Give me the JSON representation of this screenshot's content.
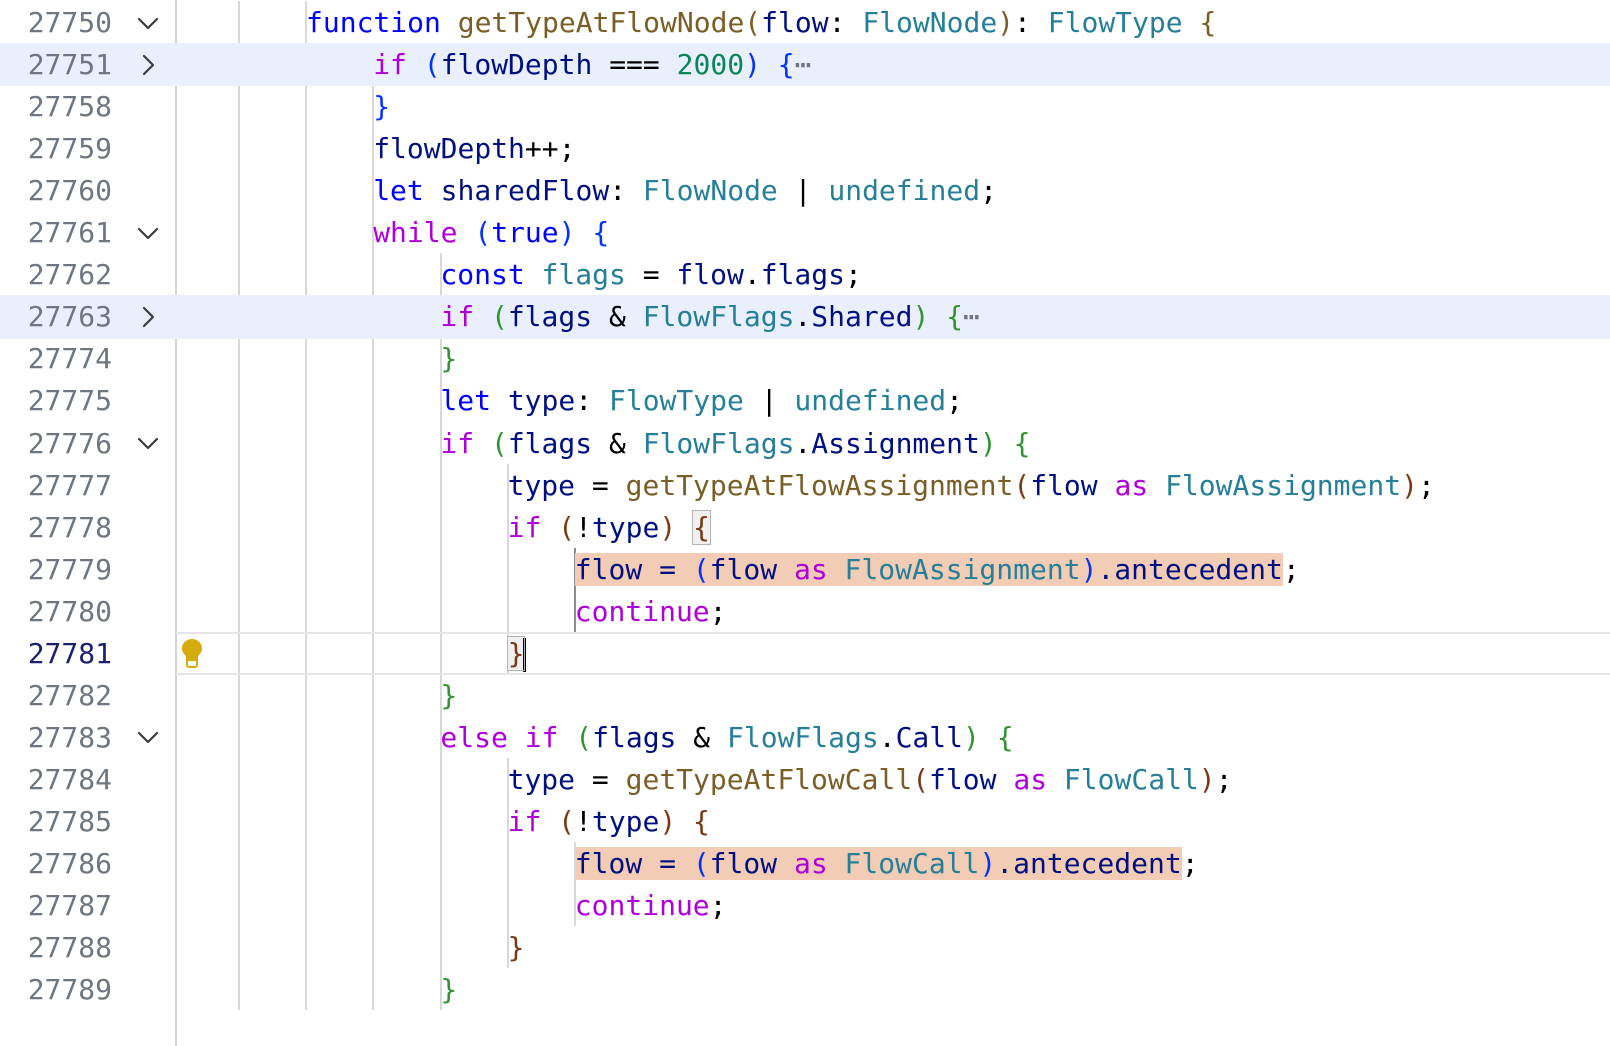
{
  "editor": {
    "language": "typescript",
    "lines": [
      {
        "number": "27750",
        "indent": 2,
        "fold": "expanded",
        "tokens": [
          [
            "function",
            "kw"
          ],
          [
            " ",
            "punc"
          ],
          [
            "getTypeAtFlowNode",
            "fn"
          ],
          [
            "(",
            "b1"
          ],
          [
            "flow",
            "var"
          ],
          [
            ": ",
            "punc"
          ],
          [
            "FlowNode",
            "type"
          ],
          [
            ")",
            "b1"
          ],
          [
            ": ",
            "punc"
          ],
          [
            "FlowType",
            "type"
          ],
          [
            " ",
            "punc"
          ],
          [
            "{",
            "b1"
          ]
        ]
      },
      {
        "number": "27751",
        "indent": 3,
        "fold": "collapsed",
        "highlight": "fold",
        "tokens": [
          [
            "if",
            "ctl"
          ],
          [
            " ",
            "punc"
          ],
          [
            "(",
            "b2"
          ],
          [
            "flowDepth",
            "var"
          ],
          [
            " === ",
            "punc"
          ],
          [
            "2000",
            "num"
          ],
          [
            ")",
            "b2"
          ],
          [
            " ",
            "punc"
          ],
          [
            "{",
            "b2"
          ],
          [
            "⋯",
            "ell"
          ]
        ]
      },
      {
        "number": "27758",
        "indent": 3,
        "tokens": [
          [
            "}",
            "b2"
          ]
        ]
      },
      {
        "number": "27759",
        "indent": 3,
        "tokens": [
          [
            "flowDepth",
            "var"
          ],
          [
            "++;",
            "punc"
          ]
        ]
      },
      {
        "number": "27760",
        "indent": 3,
        "tokens": [
          [
            "let",
            "kw"
          ],
          [
            " ",
            "punc"
          ],
          [
            "sharedFlow",
            "var"
          ],
          [
            ": ",
            "punc"
          ],
          [
            "FlowNode",
            "type"
          ],
          [
            " | ",
            "punc"
          ],
          [
            "undefined",
            "type"
          ],
          [
            ";",
            "punc"
          ]
        ]
      },
      {
        "number": "27761",
        "indent": 3,
        "fold": "expanded",
        "tokens": [
          [
            "while",
            "ctl"
          ],
          [
            " ",
            "punc"
          ],
          [
            "(",
            "b2"
          ],
          [
            "true",
            "kw"
          ],
          [
            ")",
            "b2"
          ],
          [
            " ",
            "punc"
          ],
          [
            "{",
            "b2"
          ]
        ]
      },
      {
        "number": "27762",
        "indent": 4,
        "tokens": [
          [
            "const",
            "kw"
          ],
          [
            " ",
            "punc"
          ],
          [
            "flags",
            "type"
          ],
          [
            " = ",
            "punc"
          ],
          [
            "flow",
            "var"
          ],
          [
            ".",
            "punc"
          ],
          [
            "flags",
            "var"
          ],
          [
            ";",
            "punc"
          ]
        ]
      },
      {
        "number": "27763",
        "indent": 4,
        "fold": "collapsed",
        "highlight": "fold",
        "tokens": [
          [
            "if",
            "ctl"
          ],
          [
            " ",
            "punc"
          ],
          [
            "(",
            "b3"
          ],
          [
            "flags",
            "var"
          ],
          [
            " & ",
            "punc"
          ],
          [
            "FlowFlags",
            "type"
          ],
          [
            ".",
            "punc"
          ],
          [
            "Shared",
            "var"
          ],
          [
            ")",
            "b3"
          ],
          [
            " ",
            "punc"
          ],
          [
            "{",
            "b3"
          ],
          [
            "⋯",
            "ell"
          ]
        ]
      },
      {
        "number": "27774",
        "indent": 4,
        "tokens": [
          [
            "}",
            "b3"
          ]
        ]
      },
      {
        "number": "27775",
        "indent": 4,
        "tokens": [
          [
            "let",
            "kw"
          ],
          [
            " ",
            "punc"
          ],
          [
            "type",
            "var"
          ],
          [
            ": ",
            "punc"
          ],
          [
            "FlowType",
            "type"
          ],
          [
            " | ",
            "punc"
          ],
          [
            "undefined",
            "type"
          ],
          [
            ";",
            "punc"
          ]
        ]
      },
      {
        "number": "27776",
        "indent": 4,
        "fold": "expanded",
        "tokens": [
          [
            "if",
            "ctl"
          ],
          [
            " ",
            "punc"
          ],
          [
            "(",
            "b3"
          ],
          [
            "flags",
            "var"
          ],
          [
            " & ",
            "punc"
          ],
          [
            "FlowFlags",
            "type"
          ],
          [
            ".",
            "punc"
          ],
          [
            "Assignment",
            "var"
          ],
          [
            ")",
            "b3"
          ],
          [
            " ",
            "punc"
          ],
          [
            "{",
            "b3"
          ]
        ]
      },
      {
        "number": "27777",
        "indent": 5,
        "tokens": [
          [
            "type",
            "var"
          ],
          [
            " = ",
            "punc"
          ],
          [
            "getTypeAtFlowAssignment",
            "fn"
          ],
          [
            "(",
            "b4"
          ],
          [
            "flow",
            "var"
          ],
          [
            " ",
            "punc"
          ],
          [
            "as",
            "ctl"
          ],
          [
            " ",
            "punc"
          ],
          [
            "FlowAssignment",
            "type"
          ],
          [
            ")",
            "b4"
          ],
          [
            ";",
            "punc"
          ]
        ]
      },
      {
        "number": "27778",
        "indent": 5,
        "tokens": [
          [
            "if",
            "ctl"
          ],
          [
            " ",
            "punc"
          ],
          [
            "(",
            "b4"
          ],
          [
            "!",
            "punc"
          ],
          [
            "type",
            "var"
          ],
          [
            ")",
            "b4"
          ],
          [
            " ",
            "punc"
          ],
          [
            "{",
            "b4",
            "match"
          ]
        ]
      },
      {
        "number": "27779",
        "indent": 6,
        "tokens": [
          [
            "flow = ",
            "var",
            "hl"
          ],
          [
            "(",
            "b2",
            "hl"
          ],
          [
            "flow ",
            "var",
            "hl"
          ],
          [
            "as",
            "ctl",
            "hl"
          ],
          [
            " ",
            "punc",
            "hl"
          ],
          [
            "FlowAssignment",
            "type",
            "hl"
          ],
          [
            ")",
            "b2",
            "hl"
          ],
          [
            ".antecedent",
            "var",
            "hl"
          ],
          [
            ";",
            "punc"
          ]
        ]
      },
      {
        "number": "27780",
        "indent": 6,
        "tokens": [
          [
            "continue",
            "ctl"
          ],
          [
            ";",
            "punc"
          ]
        ]
      },
      {
        "number": "27781",
        "indent": 5,
        "current": true,
        "lightbulb": true,
        "tokens": [
          [
            "}",
            "b4",
            "match"
          ],
          [
            "",
            "cursor"
          ]
        ]
      },
      {
        "number": "27782",
        "indent": 4,
        "tokens": [
          [
            "}",
            "b3"
          ]
        ]
      },
      {
        "number": "27783",
        "indent": 4,
        "fold": "expanded",
        "tokens": [
          [
            "else",
            "ctl"
          ],
          [
            " ",
            "punc"
          ],
          [
            "if",
            "ctl"
          ],
          [
            " ",
            "punc"
          ],
          [
            "(",
            "b3"
          ],
          [
            "flags",
            "var"
          ],
          [
            " & ",
            "punc"
          ],
          [
            "FlowFlags",
            "type"
          ],
          [
            ".",
            "punc"
          ],
          [
            "Call",
            "var"
          ],
          [
            ")",
            "b3"
          ],
          [
            " ",
            "punc"
          ],
          [
            "{",
            "b3"
          ]
        ]
      },
      {
        "number": "27784",
        "indent": 5,
        "tokens": [
          [
            "type",
            "var"
          ],
          [
            " = ",
            "punc"
          ],
          [
            "getTypeAtFlowCall",
            "fn"
          ],
          [
            "(",
            "b4"
          ],
          [
            "flow",
            "var"
          ],
          [
            " ",
            "punc"
          ],
          [
            "as",
            "ctl"
          ],
          [
            " ",
            "punc"
          ],
          [
            "FlowCall",
            "type"
          ],
          [
            ")",
            "b4"
          ],
          [
            ";",
            "punc"
          ]
        ]
      },
      {
        "number": "27785",
        "indent": 5,
        "tokens": [
          [
            "if",
            "ctl"
          ],
          [
            " ",
            "punc"
          ],
          [
            "(",
            "b4"
          ],
          [
            "!",
            "punc"
          ],
          [
            "type",
            "var"
          ],
          [
            ")",
            "b4"
          ],
          [
            " ",
            "punc"
          ],
          [
            "{",
            "b4"
          ]
        ]
      },
      {
        "number": "27786",
        "indent": 6,
        "tokens": [
          [
            "flow = ",
            "var",
            "hl"
          ],
          [
            "(",
            "b2",
            "hl"
          ],
          [
            "flow ",
            "var",
            "hl"
          ],
          [
            "as",
            "ctl",
            "hl"
          ],
          [
            " ",
            "punc",
            "hl"
          ],
          [
            "FlowCall",
            "type",
            "hl"
          ],
          [
            ")",
            "b2",
            "hl"
          ],
          [
            ".antecedent",
            "var",
            "hl"
          ],
          [
            ";",
            "punc"
          ]
        ]
      },
      {
        "number": "27787",
        "indent": 6,
        "tokens": [
          [
            "continue",
            "ctl"
          ],
          [
            ";",
            "punc"
          ]
        ]
      },
      {
        "number": "27788",
        "indent": 5,
        "tokens": [
          [
            "}",
            "b4"
          ]
        ]
      },
      {
        "number": "27789",
        "indent": 4,
        "tokens": [
          [
            "}",
            "b3"
          ]
        ]
      }
    ]
  },
  "icons": {
    "fold_expanded": "chevron-down-icon",
    "fold_collapsed": "chevron-right-icon",
    "lightbulb": "lightbulb-icon"
  },
  "colors": {
    "keyword": "#0000ff",
    "control": "#af00db",
    "function": "#795e26",
    "type": "#267f99",
    "variable": "#001080",
    "number": "#098658",
    "selection_highlight": "#f3ccb5",
    "fold_highlight": "#e9effc",
    "lightbulb": "#d4ac0d"
  }
}
